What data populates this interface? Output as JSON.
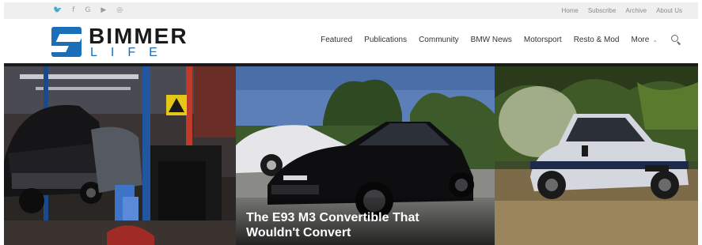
{
  "social": {
    "icons": [
      "twitter-icon",
      "facebook-icon",
      "google-plus-icon",
      "youtube-icon",
      "instagram-icon"
    ],
    "glyphs": [
      "🐦",
      "f",
      "G",
      "▶",
      "◎"
    ]
  },
  "utility_links": [
    "Home",
    "Subscribe",
    "Archive",
    "About Us"
  ],
  "brand": {
    "name": "BIMMER",
    "sub": "LIFE",
    "color": "#1b6fb8"
  },
  "nav": {
    "items": [
      "Featured",
      "Publications",
      "Community",
      "BMW News",
      "Motorsport",
      "Resto & Mod"
    ],
    "more_label": "More",
    "more_chevron": "⌄"
  },
  "hero": {
    "featured_caption_line1": "The E93 M3 Convertible That",
    "featured_caption_line2": "Wouldn't Convert"
  }
}
